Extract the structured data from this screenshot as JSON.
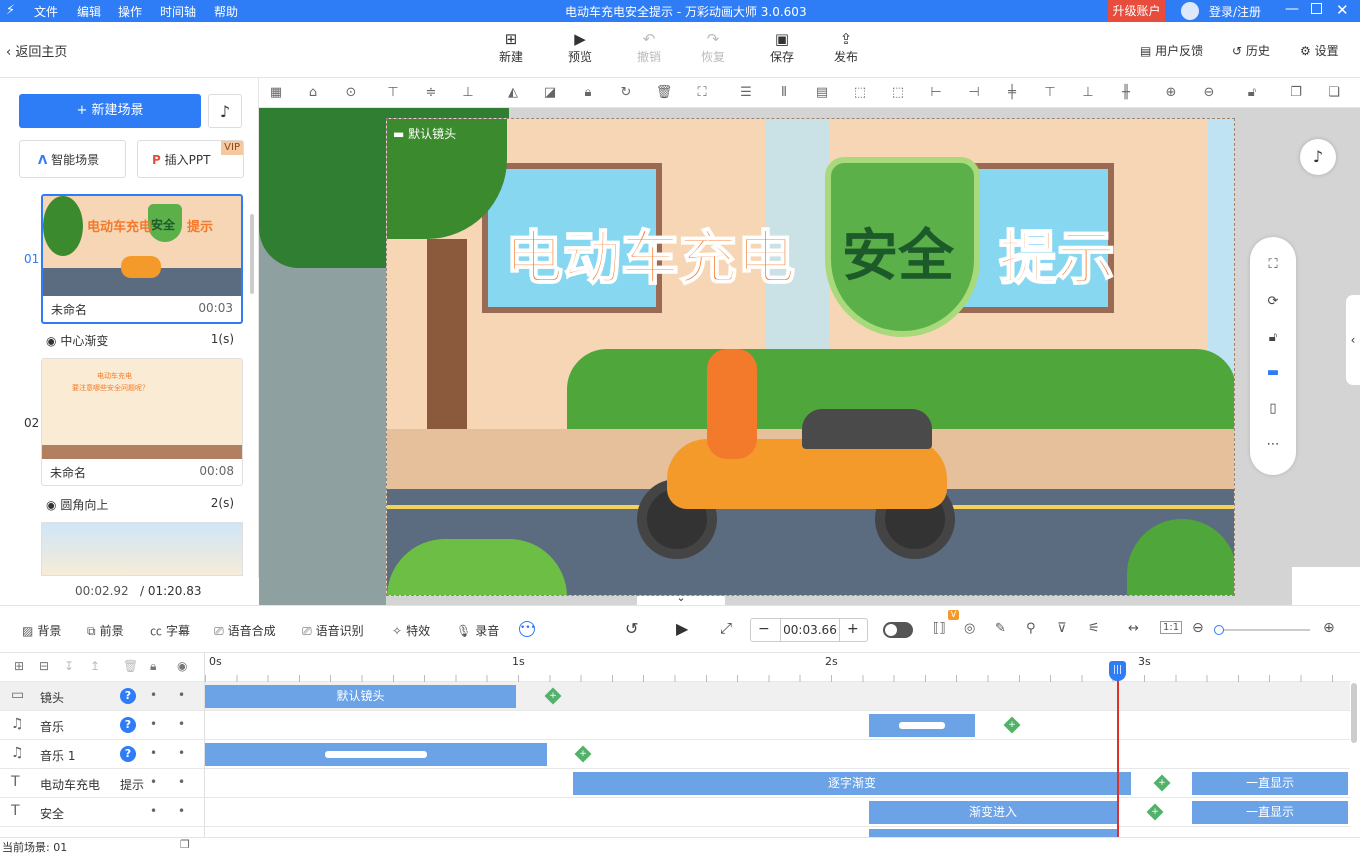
{
  "titlebar": {
    "menus": [
      "文件",
      "编辑",
      "操作",
      "时间轴",
      "帮助"
    ],
    "title": "电动车充电安全提示 - 万彩动画大师 3.0.603",
    "upgrade": "升级账户",
    "login": "登录/注册"
  },
  "toolbar": {
    "back": "返回主页",
    "new": "新建",
    "preview": "预览",
    "undo": "撤销",
    "redo": "恢复",
    "save": "保存",
    "publish": "发布",
    "feedback": "用户反馈",
    "history": "历史",
    "settings": "设置"
  },
  "left": {
    "new_scene": "新建场景",
    "smart_scene": "智能场景",
    "insert_ppt": "插入PPT",
    "vip": "VIP",
    "scenes": [
      {
        "index": "01",
        "name": "未命名",
        "duration": "00:03",
        "transition": "中心渐变",
        "trans_time": "1(s)"
      },
      {
        "index": "02",
        "name": "未命名",
        "duration": "00:08",
        "transition": "圆角向上",
        "trans_time": "2(s)",
        "thumb_line1": "电动车充电",
        "thumb_line2": "要注意哪些安全问题呢？"
      }
    ],
    "current_time": "00:02.92",
    "total_time": "/ 01:20.83"
  },
  "canvas": {
    "camera_label": "默认镜头",
    "title_part1": "电动车充电",
    "title_part2": "安全",
    "title_part3": "提示"
  },
  "timeline_bar": {
    "bg": "背景",
    "fg": "前景",
    "subtitle": "字幕",
    "voice_synth": "语音合成",
    "voice_recog": "语音识别",
    "effects": "特效",
    "record": "录音",
    "time": "00:03.66",
    "v_badge": "V"
  },
  "ruler": {
    "labels": [
      "0s",
      "1s",
      "2s",
      "3s"
    ]
  },
  "tracks": [
    {
      "name": "镜头",
      "icon": "camera-icon",
      "clips": [
        {
          "label": "默认镜头"
        }
      ]
    },
    {
      "name": "音乐",
      "icon": "music-icon",
      "clips": []
    },
    {
      "name": "音乐 1",
      "icon": "music-icon",
      "clips": []
    },
    {
      "name": "电动车充电",
      "sub": "提示",
      "icon": "text-icon",
      "clips": [
        {
          "label": "逐字渐变"
        },
        {
          "label": "一直显示"
        }
      ]
    },
    {
      "name": "安全",
      "icon": "text-icon",
      "clips": [
        {
          "label": "渐变进入"
        },
        {
          "label": "一直显示"
        }
      ]
    }
  ],
  "status": {
    "current_scene": "当前场景: 01"
  },
  "colors": {
    "accent": "#2e7cf6",
    "clip": "#6ba3e6",
    "playhead": "#e0302b",
    "key": "#53b26a",
    "title_orange": "#f37a2a",
    "shield_green": "#5bb04a"
  }
}
